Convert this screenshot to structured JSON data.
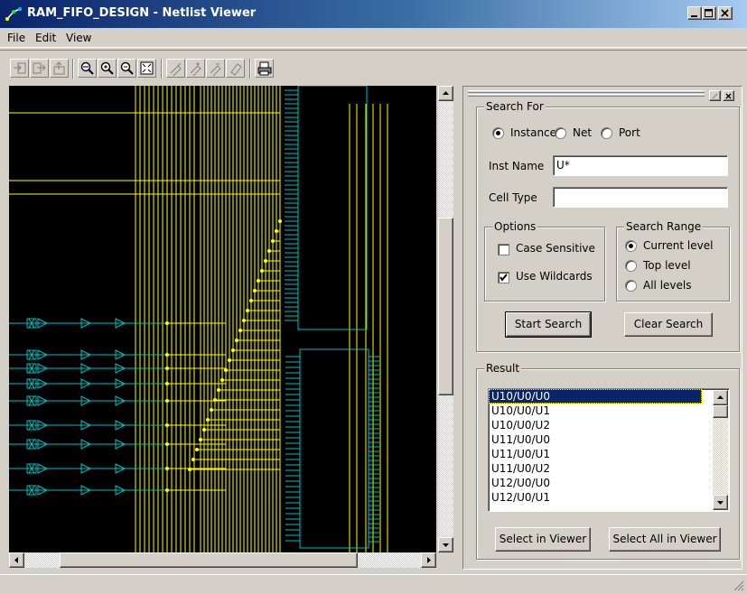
{
  "window": {
    "title": "RAM_FIFO_DESIGN - Netlist Viewer"
  },
  "menu": {
    "items": [
      "File",
      "Edit",
      "View"
    ]
  },
  "toolbar": {
    "icons": [
      "push-in-icon",
      "pop-out-icon",
      "top-level-icon",
      "zoom-select-icon",
      "zoom-in-icon",
      "zoom-out-icon",
      "fit-window-icon",
      "highlight-icon",
      "highlight-add-icon",
      "highlight-remove-icon",
      "eraser-icon",
      "print-icon"
    ]
  },
  "search": {
    "group_label": "Search For",
    "type_options": [
      "Instance",
      "Net",
      "Port"
    ],
    "type_selected": "Instance",
    "inst_name_label": "Inst Name",
    "inst_name_value": "U*",
    "cell_type_label": "Cell Type",
    "cell_type_value": "",
    "options_label": "Options",
    "case_sensitive_label": "Case Sensitive",
    "case_sensitive": false,
    "use_wildcards_label": "Use Wildcards",
    "use_wildcards": true,
    "range_label": "Search Range",
    "range_options": [
      "Current level",
      "Top level",
      "All levels"
    ],
    "range_selected": "Current level",
    "start_button": "Start Search",
    "clear_button": "Clear Search"
  },
  "result": {
    "group_label": "Result",
    "items": [
      "U10/U0/U0",
      "U10/U0/U1",
      "U10/U0/U2",
      "U11/U0/U0",
      "U11/U0/U1",
      "U11/U0/U2",
      "U12/U0/U0",
      "U12/U0/U1"
    ],
    "selected_index": 0,
    "select_button": "Select in Viewer",
    "select_all_button": "Select All in Viewer"
  },
  "colors": {
    "wire": "#ffff00",
    "component": "#00c0c0",
    "canvas": "#000000",
    "title_start": "#0a246a",
    "title_end": "#a6caf0"
  }
}
